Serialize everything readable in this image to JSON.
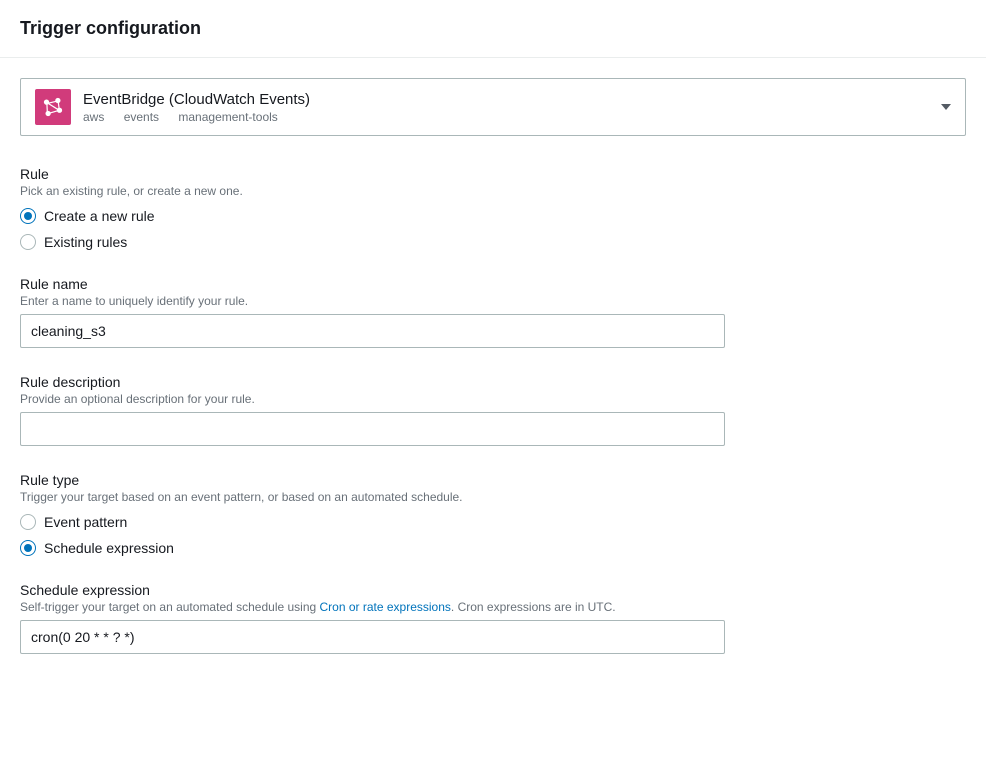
{
  "header": {
    "title": "Trigger configuration"
  },
  "trigger": {
    "name": "EventBridge (CloudWatch Events)",
    "tags": [
      "aws",
      "events",
      "management-tools"
    ]
  },
  "rule": {
    "label": "Rule",
    "help": "Pick an existing rule, or create a new one.",
    "options": {
      "create": "Create a new rule",
      "existing": "Existing rules"
    },
    "selected": "create"
  },
  "ruleName": {
    "label": "Rule name",
    "help": "Enter a name to uniquely identify your rule.",
    "value": "cleaning_s3"
  },
  "ruleDescription": {
    "label": "Rule description",
    "help": "Provide an optional description for your rule.",
    "value": ""
  },
  "ruleType": {
    "label": "Rule type",
    "help": "Trigger your target based on an event pattern, or based on an automated schedule.",
    "options": {
      "pattern": "Event pattern",
      "schedule": "Schedule expression"
    },
    "selected": "schedule"
  },
  "schedule": {
    "label": "Schedule expression",
    "helpPrefix": "Self-trigger your target on an automated schedule using ",
    "helpLink": "Cron or rate expressions",
    "helpSuffix": ". Cron expressions are in UTC.",
    "value": "cron(0 20 * * ? *)"
  }
}
